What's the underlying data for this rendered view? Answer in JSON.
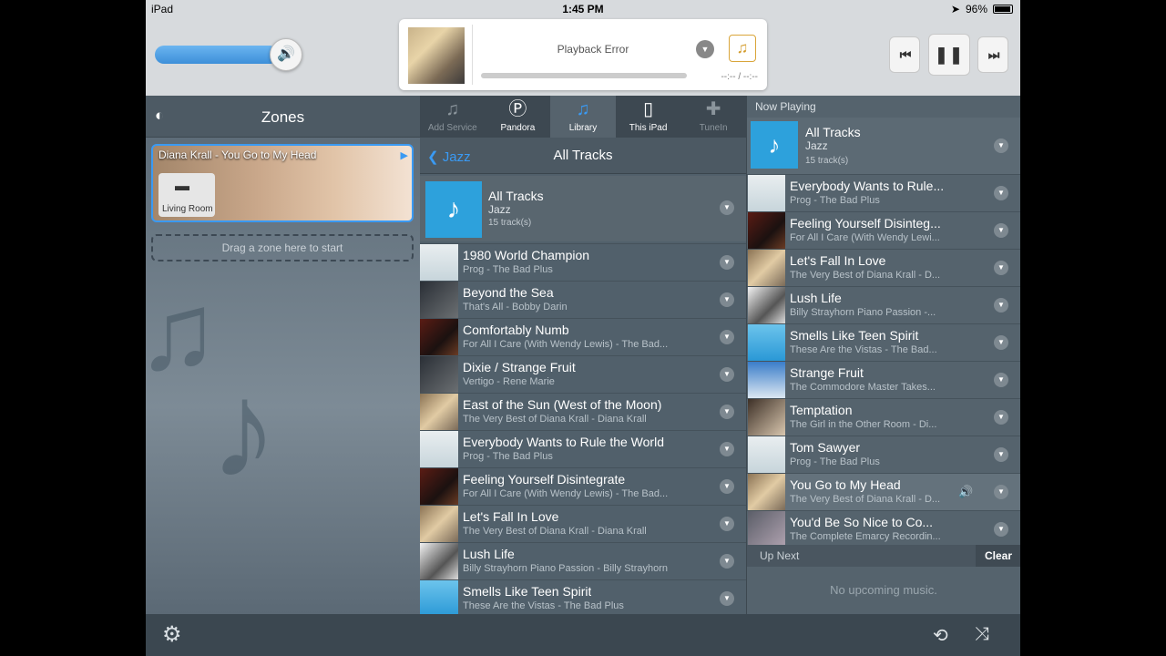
{
  "status": {
    "device": "iPad",
    "time": "1:45 PM",
    "battery": "96%"
  },
  "nowplaying": {
    "message": "Playback Error",
    "time": "--:-- / --:--"
  },
  "transport": {
    "prev": "⏮",
    "pause": "❚❚",
    "next": "⏭"
  },
  "zones": {
    "title": "Zones",
    "zone": {
      "track": "Diana Krall - You Go to My Head",
      "room": "Living Room"
    },
    "drop_hint": "Drag a zone here to start"
  },
  "library": {
    "sources": [
      {
        "label": "Add Service",
        "icon": "add-service-icon"
      },
      {
        "label": "Pandora",
        "icon": "pandora-icon"
      },
      {
        "label": "Library",
        "icon": "library-icon"
      },
      {
        "label": "This iPad",
        "icon": "ipad-icon"
      },
      {
        "label": "TuneIn",
        "icon": "tunein-icon"
      }
    ],
    "back": "Jazz",
    "title": "All Tracks",
    "header": {
      "title": "All Tracks",
      "genre": "Jazz",
      "count": "15 track(s)"
    },
    "tracks": [
      {
        "name": "1980 World Champion",
        "sub": "Prog - The Bad Plus"
      },
      {
        "name": "Beyond the Sea",
        "sub": "That's All - Bobby Darin"
      },
      {
        "name": "Comfortably Numb",
        "sub": "For All I Care (With Wendy Lewis) - The Bad..."
      },
      {
        "name": "Dixie / Strange Fruit",
        "sub": "Vertigo - Rene Marie"
      },
      {
        "name": "East of the Sun (West of the Moon)",
        "sub": "The Very Best of Diana Krall - Diana Krall"
      },
      {
        "name": "Everybody Wants to Rule the World",
        "sub": "Prog - The Bad Plus"
      },
      {
        "name": "Feeling Yourself Disintegrate",
        "sub": "For All I Care (With Wendy Lewis) - The Bad..."
      },
      {
        "name": "Let's Fall In Love",
        "sub": "The Very Best of Diana Krall - Diana Krall"
      },
      {
        "name": "Lush Life",
        "sub": "Billy Strayhorn Piano Passion - Billy Strayhorn"
      },
      {
        "name": "Smells Like Teen Spirit",
        "sub": "These Are the Vistas - The Bad Plus"
      }
    ]
  },
  "queue": {
    "title": "Now Playing",
    "header": {
      "title": "All Tracks",
      "genre": "Jazz",
      "count": "15 track(s)"
    },
    "tracks": [
      {
        "name": "Everybody Wants to Rule...",
        "sub": "Prog - The Bad Plus"
      },
      {
        "name": "Feeling Yourself Disinteg...",
        "sub": "For All I Care (With Wendy Lewi..."
      },
      {
        "name": "Let's Fall In Love",
        "sub": "The Very Best of Diana Krall - D..."
      },
      {
        "name": "Lush Life",
        "sub": "Billy Strayhorn Piano Passion -..."
      },
      {
        "name": "Smells Like Teen Spirit",
        "sub": "These Are the Vistas - The Bad..."
      },
      {
        "name": "Strange Fruit",
        "sub": "The Commodore Master Takes..."
      },
      {
        "name": "Temptation",
        "sub": "The Girl in the Other Room - Di..."
      },
      {
        "name": "Tom Sawyer",
        "sub": "Prog - The Bad Plus"
      },
      {
        "name": "You Go to My Head",
        "sub": "The Very Best of Diana Krall - D..."
      },
      {
        "name": "You'd Be So Nice to Co...",
        "sub": "The Complete Emarcy Recordin..."
      }
    ],
    "up_next": "Up Next",
    "clear": "Clear",
    "empty": "No upcoming music."
  },
  "colors": {
    "accent": "#3a9af3",
    "panel": "#51606b",
    "topbar": "#d7dadd"
  }
}
